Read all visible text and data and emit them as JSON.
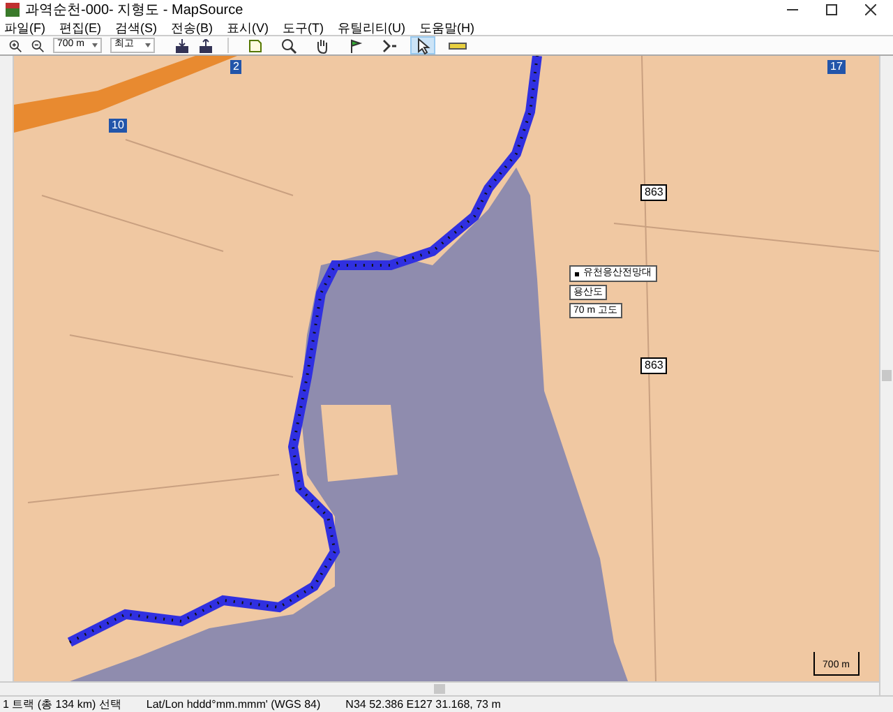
{
  "window": {
    "title": "과역순천-000- 지형도 - MapSource"
  },
  "menu": [
    "파일(F)",
    "편집(E)",
    "검색(S)",
    "전송(B)",
    "표시(V)",
    "도구(T)",
    "유틸리티(U)",
    "도움말(H)"
  ],
  "toolbar": {
    "zoom_scale": "700 m",
    "detail": "최고",
    "tools": [
      {
        "kind": "map",
        "selected": false
      },
      {
        "kind": "zoom",
        "selected": false
      },
      {
        "kind": "hand",
        "selected": false
      },
      {
        "kind": "waypoint",
        "selected": false
      },
      {
        "kind": "route",
        "selected": false
      },
      {
        "kind": "select",
        "selected": true
      },
      {
        "kind": "measure",
        "selected": false
      }
    ]
  },
  "map": {
    "road_shields": [
      "2",
      "10",
      "17",
      "863",
      "863"
    ],
    "tooltip": {
      "title": "유천응산전망대",
      "name": "용산도",
      "elevation": "70 m 고도"
    },
    "scale": "700 m"
  },
  "status_bar": [
    "1 트랙 (총 134 km) 선택",
    "Lat/Lon hddd°mm.mmm' (WGS 84)",
    "N34 52.386 E127 31.168, 73 m"
  ]
}
